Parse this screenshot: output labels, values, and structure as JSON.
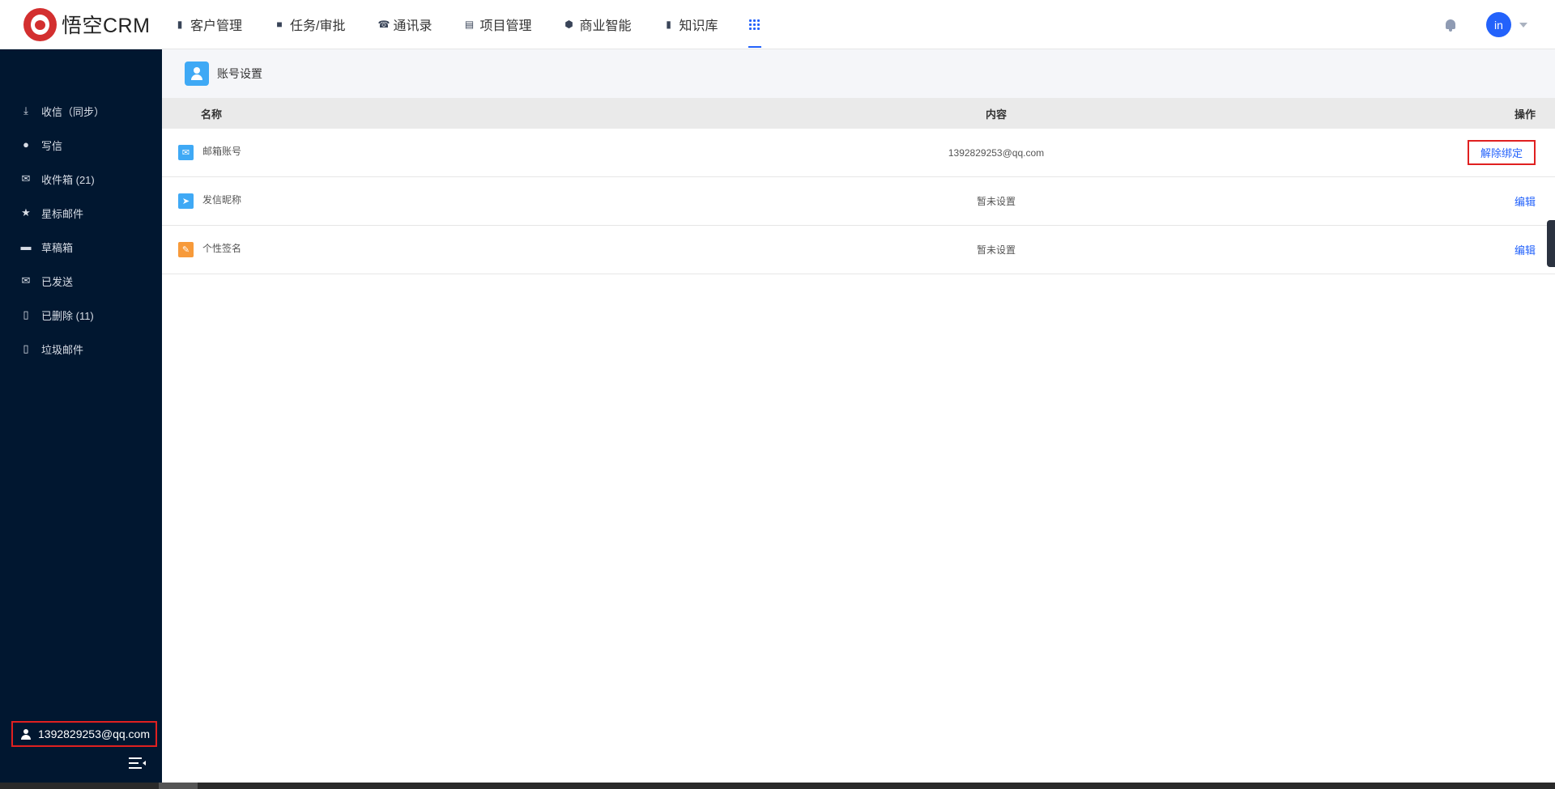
{
  "header": {
    "logo_text": "悟空CRM",
    "nav": [
      {
        "label": "客户管理",
        "icon": "building-icon"
      },
      {
        "label": "任务/审批",
        "icon": "briefcase-icon"
      },
      {
        "label": "通讯录",
        "icon": "phone-book-icon"
      },
      {
        "label": "项目管理",
        "icon": "kanban-icon"
      },
      {
        "label": "商业智能",
        "icon": "cube-icon"
      },
      {
        "label": "知识库",
        "icon": "book-icon"
      }
    ],
    "apps_icon": "grid-icon",
    "avatar_text": "in",
    "accent_color": "#2362fb"
  },
  "sidebar": {
    "items": [
      {
        "label": "收信（同步）",
        "icon": "download-icon"
      },
      {
        "label": "写信",
        "icon": "compass-icon"
      },
      {
        "label": "收件箱 (21)",
        "icon": "envelope-icon"
      },
      {
        "label": "星标邮件",
        "icon": "star-icon"
      },
      {
        "label": "草稿箱",
        "icon": "archive-icon"
      },
      {
        "label": "已发送",
        "icon": "envelope-icon"
      },
      {
        "label": "已删除 (11)",
        "icon": "trash-icon"
      },
      {
        "label": "垃圾邮件",
        "icon": "spam-trash-icon"
      }
    ],
    "account": "1392829253@qq.com",
    "background": "#011730"
  },
  "main": {
    "title": "账号设置",
    "columns": {
      "name": "名称",
      "content": "内容",
      "action": "操作"
    },
    "rows": [
      {
        "name": "邮箱账号",
        "content": "1392829253@qq.com",
        "action": "解除绑定",
        "icon": "mail-icon",
        "icon_color": "#3fa9f5"
      },
      {
        "name": "发信昵称",
        "content": "暂未设置",
        "action": "编辑",
        "icon": "send-icon",
        "icon_color": "#3fa9f5"
      },
      {
        "name": "个性签名",
        "content": "暂未设置",
        "action": "编辑",
        "icon": "signature-icon",
        "icon_color": "#f79a3a"
      }
    ]
  }
}
